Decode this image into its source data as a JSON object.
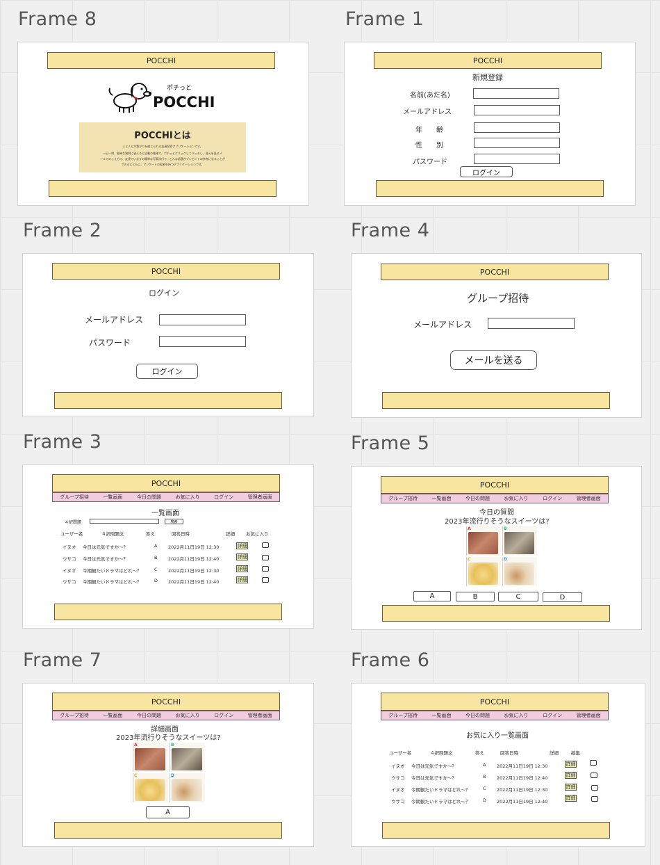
{
  "frame_titles": {
    "f8": "Frame 8",
    "f1": "Frame 1",
    "f2": "Frame 2",
    "f4": "Frame 4",
    "f3": "Frame 3",
    "f5": "Frame 5",
    "f7": "Frame 7",
    "f6": "Frame 6"
  },
  "app_name": "POCCHI",
  "nav": [
    "グループ招待",
    "一覧画面",
    "今日の問題",
    "お気に入り",
    "ログイン",
    "管理者画面"
  ],
  "frame8": {
    "logo_small": "ポチっと",
    "logo_big": "POCCHI",
    "hero_title": "POCCHIとは",
    "hero_line1": "人と人とが繋がりを感じられる友達探索アプリケーションです。",
    "hero_line2": "一日一問、簡単な質問に答えると自動の結果で、ポチっとクリックしてマッチし、答えを見るメ",
    "hero_line3": "ールでのこえ方で、友達でいなりの簡単な写真添付で、どんな話題がプレゼントの参考になることが",
    "hero_line4": "できるとともに、アンケートの役割を持つアプリケーションです。"
  },
  "frame1": {
    "heading": "新規登録",
    "labels": [
      "名前(あだ名)",
      "メールアドレス",
      "年　　齢",
      "性　　別",
      "パスワード"
    ],
    "button": "ログイン"
  },
  "frame2": {
    "heading": "ログイン",
    "email_label": "メールアドレス",
    "password_label": "パスワード",
    "button": "ログイン"
  },
  "frame4": {
    "heading": "グループ招待",
    "email_label": "メールアドレス",
    "button": "メールを送る"
  },
  "frame3": {
    "heading": "一覧画面",
    "search_label": "４択問題",
    "search_button": "検索",
    "columns": [
      "ユーザー名",
      "４択問題文",
      "答え",
      "回答日時",
      "詳細",
      "お気に入り"
    ],
    "rows": [
      {
        "user": "イヌオ",
        "question": "今日は元気ですか〜？",
        "answer": "A",
        "date": "2022月11日19日 12:30",
        "detail": "詳細"
      },
      {
        "user": "ウサコ",
        "question": "今日は元気ですか〜？",
        "answer": "B",
        "date": "2022月11日19日 12:40",
        "detail": "詳細"
      },
      {
        "user": "イヌオ",
        "question": "今期観たいドラマはどれ〜？",
        "answer": "C",
        "date": "2022月11日19日 12:30",
        "detail": "詳細"
      },
      {
        "user": "ウサコ",
        "question": "今期観たいドラマはどれ〜？",
        "answer": "D",
        "date": "2022月11日19日 12:40",
        "detail": "詳細"
      }
    ]
  },
  "frame5": {
    "heading": "今日の質問",
    "question": "2023年流行りそうなスイーツは?",
    "choices": [
      "A",
      "B",
      "C",
      "D"
    ]
  },
  "frame7": {
    "heading": "詳細画面",
    "question": "2023年流行りそうなスイーツは?",
    "answer": "A"
  },
  "frame6": {
    "heading": "お気に入り一覧画面",
    "columns": [
      "ユーザー名",
      "４択問題文",
      "答え",
      "回答日時",
      "詳細",
      "編集"
    ],
    "rows": [
      {
        "user": "イヌオ",
        "question": "今日は元気ですか〜？",
        "answer": "A",
        "date": "2022月11日19日 12:30",
        "detail": "詳細"
      },
      {
        "user": "ウサコ",
        "question": "今日は元気ですか〜？",
        "answer": "B",
        "date": "2022月11日19日 12:40",
        "detail": "詳細"
      },
      {
        "user": "イヌオ",
        "question": "今期観たいドラマはどれ〜？",
        "answer": "C",
        "date": "2022月11日19日 12:30",
        "detail": "詳細"
      },
      {
        "user": "ウサコ",
        "question": "今期観たいドラマはどれ〜？",
        "answer": "D",
        "date": "2022月11日19日 12:40",
        "detail": "詳細"
      }
    ]
  },
  "grid_letters": [
    "A",
    "B",
    "C",
    "D"
  ],
  "colors": {
    "header": "#f8e6a0",
    "nav": "#f2cde0",
    "hero": "#f3e3b3"
  }
}
